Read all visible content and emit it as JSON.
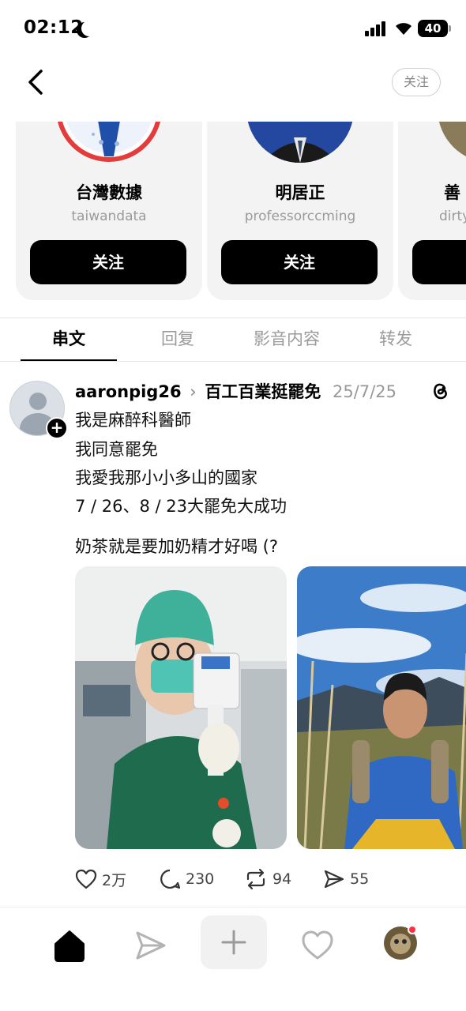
{
  "status_bar": {
    "time": "02:12",
    "battery": "40"
  },
  "header": {
    "follow_label": "关注"
  },
  "suggestions": [
    {
      "name": "台灣數據",
      "handle": "taiwandata",
      "follow_label": "关注"
    },
    {
      "name": "明居正",
      "handle": "professorccming",
      "follow_label": "关注"
    },
    {
      "name": "善",
      "handle": "dirty",
      "follow_label": ""
    }
  ],
  "tabs": [
    "串文",
    "回复",
    "影音内容",
    "转发"
  ],
  "active_tab": "串文",
  "post": {
    "username": "aaronpig26",
    "community": "百工百業挺罷免",
    "date": "25/7/25",
    "lines": [
      "我是麻醉科醫師",
      "我同意罷免",
      "我愛我那小小多山的國家",
      "7 / 26、8 / 23大罷免大成功",
      "奶茶就是要加奶精才好喝 (?"
    ],
    "likes": "2万",
    "comments": "230",
    "reposts": "94",
    "shares": "55"
  },
  "colors": {
    "accent": "#000000",
    "muted": "#9a9a9a",
    "notification": "#ff3040"
  },
  "icons": [
    "back-arrow-icon",
    "threads-icon",
    "heart-icon",
    "comment-icon",
    "repost-icon",
    "send-icon",
    "home-icon",
    "plus-icon"
  ]
}
